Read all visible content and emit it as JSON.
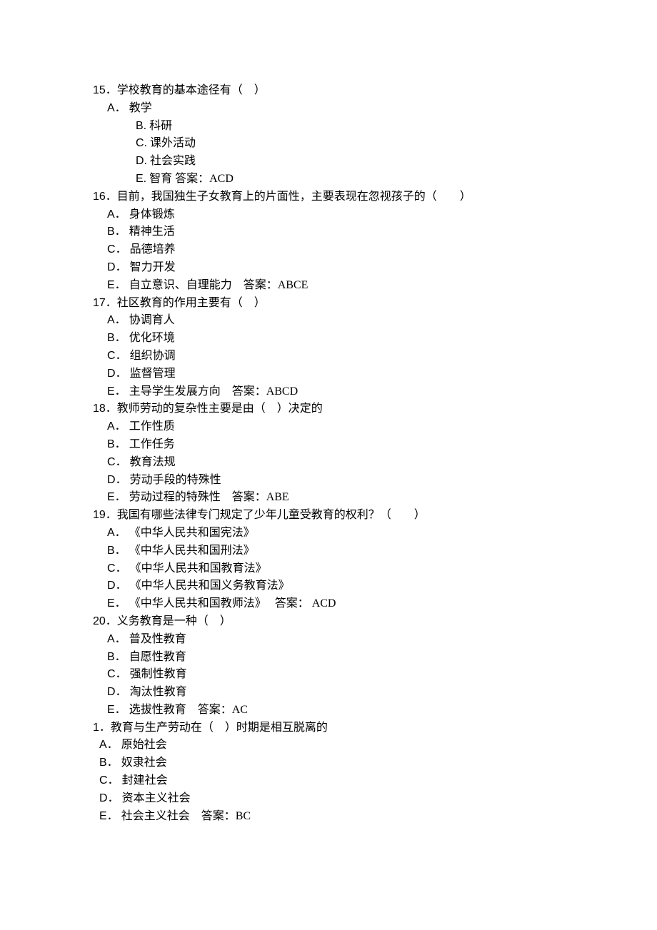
{
  "questions": [
    {
      "num": "15",
      "stem": "．学校教育的基本途径有（　）",
      "opts": [
        {
          "letter": "A",
          "sep": "．",
          "text": "教学",
          "style": "opt"
        },
        {
          "letter": "B.",
          "sep": "",
          "text": "科研",
          "style": "opt-indent2"
        },
        {
          "letter": "C.",
          "sep": "",
          "text": "课外活动",
          "style": "opt-indent2"
        },
        {
          "letter": "D.",
          "sep": "",
          "text": "社会实践",
          "style": "opt-indent2"
        },
        {
          "letter": "E.",
          "sep": "",
          "text": "智育  答案：ACD",
          "style": "opt-indent2"
        }
      ]
    },
    {
      "num": "16",
      "stem": "．目前，我国独生子女教育上的片面性，主要表现在忽视孩子的（　　）",
      "opts": [
        {
          "letter": "A",
          "sep": "．",
          "text": "身体锻炼",
          "style": "opt"
        },
        {
          "letter": "B",
          "sep": "．",
          "text": "精神生活",
          "style": "opt"
        },
        {
          "letter": "C",
          "sep": "．",
          "text": "品德培养",
          "style": "opt"
        },
        {
          "letter": "D",
          "sep": "．",
          "text": "智力开发",
          "style": "opt"
        },
        {
          "letter": "E",
          "sep": "．",
          "text": "自立意识、自理能力　答案：ABCE",
          "style": "opt"
        }
      ]
    },
    {
      "num": "17",
      "stem": "．社区教育的作用主要有（　）",
      "opts": [
        {
          "letter": "A",
          "sep": "．",
          "text": "协调育人",
          "style": "opt"
        },
        {
          "letter": "B",
          "sep": "．",
          "text": "优化环境",
          "style": "opt"
        },
        {
          "letter": "C",
          "sep": "．",
          "text": "组织协调",
          "style": "opt"
        },
        {
          "letter": "D",
          "sep": "．",
          "text": "监督管理",
          "style": "opt"
        },
        {
          "letter": "E",
          "sep": "．",
          "text": "主导学生发展方向　答案：ABCD",
          "style": "opt"
        }
      ]
    },
    {
      "num": "18",
      "stem": "．教师劳动的复杂性主要是由（　）决定的",
      "opts": [
        {
          "letter": "A",
          "sep": "．",
          "text": "工作性质",
          "style": "opt"
        },
        {
          "letter": "B",
          "sep": "．",
          "text": "工作任务",
          "style": "opt"
        },
        {
          "letter": "C",
          "sep": "．",
          "text": "教育法规",
          "style": "opt"
        },
        {
          "letter": "D",
          "sep": "．",
          "text": "劳动手段的特殊性",
          "style": "opt"
        },
        {
          "letter": "E",
          "sep": "．",
          "text": "劳动过程的特殊性　答案：ABE",
          "style": "opt"
        }
      ]
    },
    {
      "num": "19",
      "stem": "．我国有哪些法律专门规定了少年儿童受教育的权利？（　　）",
      "opts": [
        {
          "letter": "A",
          "sep": "．",
          "text": "《中华人民共和国宪法》",
          "style": "opt"
        },
        {
          "letter": "B",
          "sep": "．",
          "text": "《中华人民共和国刑法》",
          "style": "opt"
        },
        {
          "letter": "C",
          "sep": "．",
          "text": "《中华人民共和国教育法》",
          "style": "opt"
        },
        {
          "letter": "D",
          "sep": "．",
          "text": "《中华人民共和国义务教育法》",
          "style": "opt"
        },
        {
          "letter": "E",
          "sep": "．",
          "text": "《中华人民共和国教师法》　 答案： ACD",
          "style": "opt"
        }
      ]
    },
    {
      "num": "20",
      "stem": "．义务教育是一种（　）",
      "opts": [
        {
          "letter": "A",
          "sep": "．",
          "text": "普及性教育",
          "style": "opt"
        },
        {
          "letter": "B",
          "sep": "．",
          "text": "自愿性教育",
          "style": "opt"
        },
        {
          "letter": "C",
          "sep": "．",
          "text": "强制性教育",
          "style": "opt"
        },
        {
          "letter": "D",
          "sep": "．",
          "text": "淘汰性教育",
          "style": "opt"
        },
        {
          "letter": "E",
          "sep": "．",
          "text": "选拔性教育　答案：AC",
          "style": "opt"
        }
      ]
    },
    {
      "num": "1",
      "stem": "．教育与生产劳动在（　）时期是相互脱离的",
      "opts": [
        {
          "letter": "A",
          "sep": "．",
          "text": "原始社会",
          "style": "opt",
          "pad": "9px"
        },
        {
          "letter": "B",
          "sep": "．",
          "text": "奴隶社会",
          "style": "opt",
          "pad": "9px"
        },
        {
          "letter": "C",
          "sep": "．",
          "text": "封建社会",
          "style": "opt",
          "pad": "9px"
        },
        {
          "letter": "D",
          "sep": "．",
          "text": "资本主义社会",
          "style": "opt",
          "pad": "9px"
        },
        {
          "letter": "E",
          "sep": "．",
          "text": "社会主义社会　答案：BC",
          "style": "opt",
          "pad": "9px"
        }
      ]
    }
  ]
}
